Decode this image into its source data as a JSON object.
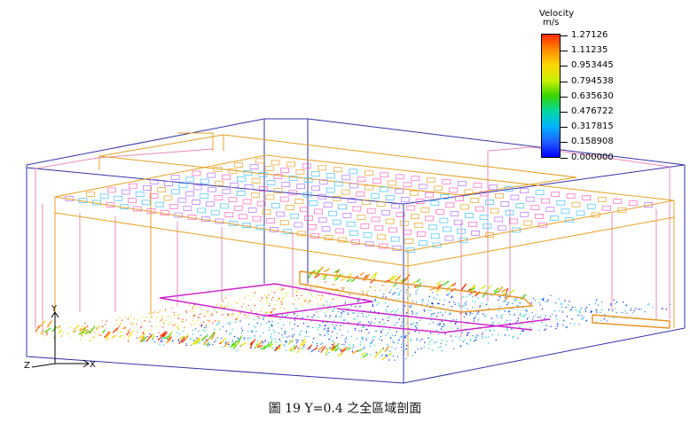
{
  "legend": {
    "title": "Velocity",
    "unit": "m/s",
    "ticks": [
      "1.27126",
      "1.11235",
      "0.953445",
      "0.794538",
      "0.635630",
      "0.476722",
      "0.317815",
      "0.158908",
      "0.000000"
    ],
    "colors": [
      "#ff2a00",
      "#ff8c00",
      "#ffd700",
      "#c8f000",
      "#3ad400",
      "#00d9a0",
      "#00b4ff",
      "#2060ff",
      "#0000ff"
    ]
  },
  "axes": {
    "y": "Y",
    "z": "Z",
    "x": "X"
  },
  "caption": "圖 19 Y=0.4 之全區域剖面"
}
